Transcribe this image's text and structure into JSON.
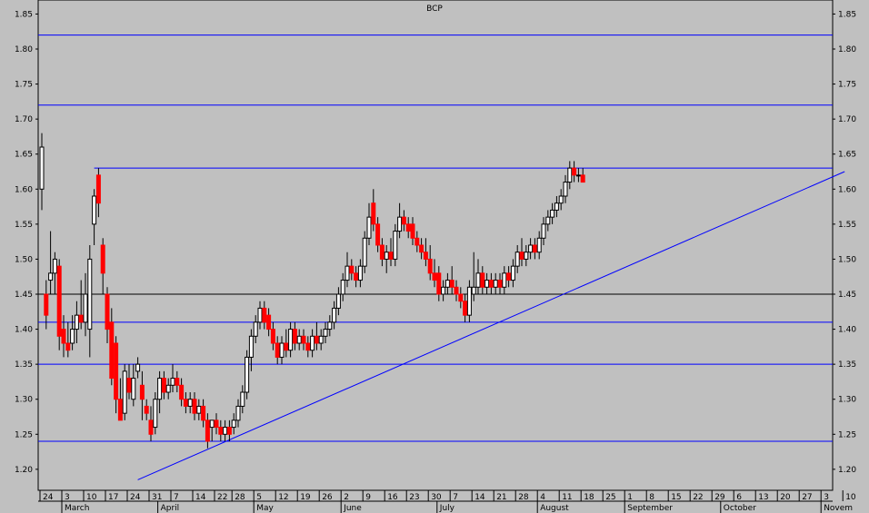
{
  "chart_data": {
    "type": "candlestick",
    "title": "BCP",
    "ylim": [
      1.17,
      1.87
    ],
    "y_ticks": [
      "1.85",
      "1.80",
      "1.75",
      "1.70",
      "1.65",
      "1.60",
      "1.55",
      "1.50",
      "1.45",
      "1.40",
      "1.35",
      "1.30",
      "1.25",
      "1.20"
    ],
    "x_range": [
      0,
      124
    ],
    "x_day_ticks": [
      {
        "label": "24",
        "x": 0
      },
      {
        "label": "3",
        "x": 5
      },
      {
        "label": "10",
        "x": 10
      },
      {
        "label": "17",
        "x": 15
      },
      {
        "label": "24",
        "x": 20
      },
      {
        "label": "31",
        "x": 25
      },
      {
        "label": "7",
        "x": 30
      },
      {
        "label": "14",
        "x": 35
      },
      {
        "label": "22",
        "x": 40
      },
      {
        "label": "28",
        "x": 44
      },
      {
        "label": "5",
        "x": 49
      },
      {
        "label": "12",
        "x": 54
      },
      {
        "label": "19",
        "x": 59
      },
      {
        "label": "26",
        "x": 64
      },
      {
        "label": "2",
        "x": 69
      },
      {
        "label": "9",
        "x": 74
      },
      {
        "label": "16",
        "x": 79
      },
      {
        "label": "23",
        "x": 84
      },
      {
        "label": "30",
        "x": 89
      },
      {
        "label": "7",
        "x": 94
      },
      {
        "label": "14",
        "x": 99
      },
      {
        "label": "21",
        "x": 104
      },
      {
        "label": "28",
        "x": 109
      },
      {
        "label": "4",
        "x": 114
      },
      {
        "label": "11",
        "x": 119
      },
      {
        "label": "18",
        "x": 124
      },
      {
        "label": "25",
        "x": 129
      },
      {
        "label": "1",
        "x": 134
      },
      {
        "label": "8",
        "x": 139
      },
      {
        "label": "15",
        "x": 144
      },
      {
        "label": "22",
        "x": 149
      },
      {
        "label": "29",
        "x": 154
      },
      {
        "label": "6",
        "x": 159
      },
      {
        "label": "13",
        "x": 164
      },
      {
        "label": "20",
        "x": 169
      },
      {
        "label": "27",
        "x": 174
      },
      {
        "label": "3",
        "x": 179
      },
      {
        "label": "10",
        "x": 184
      }
    ],
    "x_month_ticks": [
      {
        "label": "March",
        "x": 5
      },
      {
        "label": "April",
        "x": 27
      },
      {
        "label": "May",
        "x": 49
      },
      {
        "label": "June",
        "x": 69
      },
      {
        "label": "July",
        "x": 91
      },
      {
        "label": "August",
        "x": 114
      },
      {
        "label": "September",
        "x": 134
      },
      {
        "label": "October",
        "x": 156
      },
      {
        "label": "Novem",
        "x": 179
      }
    ],
    "hlines": [
      {
        "y": 1.82,
        "color": "#0000ff",
        "x_start": 0
      },
      {
        "y": 1.72,
        "color": "#0000ff",
        "x_start": 0
      },
      {
        "y": 1.63,
        "color": "#0000ff",
        "x_start": 12
      },
      {
        "y": 1.45,
        "color": "#000000",
        "x_start": 0
      },
      {
        "y": 1.41,
        "color": "#0000ff",
        "x_start": 0
      },
      {
        "y": 1.35,
        "color": "#0000ff",
        "x_start": 0
      },
      {
        "y": 1.24,
        "color": "#0000ff",
        "x_start": 0
      }
    ],
    "trendline": {
      "x1": 22,
      "y1": 1.185,
      "x2": 184,
      "y2": 1.625,
      "color": "#0000ff"
    },
    "up_color": "#ffffff",
    "down_color": "#ff0000",
    "candles": [
      {
        "x": 0,
        "o": 1.6,
        "h": 1.68,
        "l": 1.57,
        "c": 1.66
      },
      {
        "x": 1,
        "o": 1.45,
        "h": 1.47,
        "l": 1.4,
        "c": 1.42
      },
      {
        "x": 2,
        "o": 1.47,
        "h": 1.54,
        "l": 1.45,
        "c": 1.48
      },
      {
        "x": 3,
        "o": 1.48,
        "h": 1.51,
        "l": 1.45,
        "c": 1.5
      },
      {
        "x": 4,
        "o": 1.49,
        "h": 1.5,
        "l": 1.37,
        "c": 1.39
      },
      {
        "x": 5,
        "o": 1.4,
        "h": 1.42,
        "l": 1.36,
        "c": 1.38
      },
      {
        "x": 6,
        "o": 1.38,
        "h": 1.41,
        "l": 1.36,
        "c": 1.37
      },
      {
        "x": 7,
        "o": 1.38,
        "h": 1.42,
        "l": 1.37,
        "c": 1.4
      },
      {
        "x": 8,
        "o": 1.4,
        "h": 1.44,
        "l": 1.38,
        "c": 1.42
      },
      {
        "x": 9,
        "o": 1.42,
        "h": 1.47,
        "l": 1.4,
        "c": 1.41
      },
      {
        "x": 10,
        "o": 1.41,
        "h": 1.48,
        "l": 1.39,
        "c": 1.45
      },
      {
        "x": 11,
        "o": 1.4,
        "h": 1.52,
        "l": 1.36,
        "c": 1.5
      },
      {
        "x": 12,
        "o": 1.55,
        "h": 1.6,
        "l": 1.52,
        "c": 1.59
      },
      {
        "x": 13,
        "o": 1.62,
        "h": 1.63,
        "l": 1.56,
        "c": 1.58
      },
      {
        "x": 14,
        "o": 1.52,
        "h": 1.53,
        "l": 1.45,
        "c": 1.48
      },
      {
        "x": 15,
        "o": 1.45,
        "h": 1.46,
        "l": 1.38,
        "c": 1.4
      },
      {
        "x": 16,
        "o": 1.41,
        "h": 1.43,
        "l": 1.32,
        "c": 1.33
      },
      {
        "x": 17,
        "o": 1.38,
        "h": 1.39,
        "l": 1.28,
        "c": 1.3
      },
      {
        "x": 18,
        "o": 1.3,
        "h": 1.33,
        "l": 1.27,
        "c": 1.27
      },
      {
        "x": 19,
        "o": 1.28,
        "h": 1.35,
        "l": 1.27,
        "c": 1.34
      },
      {
        "x": 20,
        "o": 1.33,
        "h": 1.35,
        "l": 1.3,
        "c": 1.31
      },
      {
        "x": 21,
        "o": 1.3,
        "h": 1.35,
        "l": 1.29,
        "c": 1.33
      },
      {
        "x": 22,
        "o": 1.34,
        "h": 1.36,
        "l": 1.33,
        "c": 1.35
      },
      {
        "x": 23,
        "o": 1.32,
        "h": 1.34,
        "l": 1.27,
        "c": 1.3
      },
      {
        "x": 24,
        "o": 1.29,
        "h": 1.3,
        "l": 1.27,
        "c": 1.28
      },
      {
        "x": 25,
        "o": 1.27,
        "h": 1.29,
        "l": 1.24,
        "c": 1.25
      },
      {
        "x": 26,
        "o": 1.26,
        "h": 1.31,
        "l": 1.25,
        "c": 1.3
      },
      {
        "x": 27,
        "o": 1.3,
        "h": 1.34,
        "l": 1.28,
        "c": 1.33
      },
      {
        "x": 28,
        "o": 1.33,
        "h": 1.34,
        "l": 1.3,
        "c": 1.31
      },
      {
        "x": 29,
        "o": 1.31,
        "h": 1.33,
        "l": 1.3,
        "c": 1.32
      },
      {
        "x": 30,
        "o": 1.32,
        "h": 1.35,
        "l": 1.31,
        "c": 1.33
      },
      {
        "x": 31,
        "o": 1.33,
        "h": 1.34,
        "l": 1.31,
        "c": 1.32
      },
      {
        "x": 32,
        "o": 1.32,
        "h": 1.33,
        "l": 1.29,
        "c": 1.3
      },
      {
        "x": 33,
        "o": 1.3,
        "h": 1.31,
        "l": 1.28,
        "c": 1.29
      },
      {
        "x": 34,
        "o": 1.29,
        "h": 1.31,
        "l": 1.28,
        "c": 1.3
      },
      {
        "x": 35,
        "o": 1.3,
        "h": 1.31,
        "l": 1.27,
        "c": 1.28
      },
      {
        "x": 36,
        "o": 1.28,
        "h": 1.3,
        "l": 1.27,
        "c": 1.29
      },
      {
        "x": 37,
        "o": 1.29,
        "h": 1.3,
        "l": 1.26,
        "c": 1.27
      },
      {
        "x": 38,
        "o": 1.27,
        "h": 1.28,
        "l": 1.23,
        "c": 1.24
      },
      {
        "x": 39,
        "o": 1.26,
        "h": 1.27,
        "l": 1.24,
        "c": 1.27
      },
      {
        "x": 40,
        "o": 1.27,
        "h": 1.28,
        "l": 1.25,
        "c": 1.26
      },
      {
        "x": 41,
        "o": 1.26,
        "h": 1.27,
        "l": 1.24,
        "c": 1.25
      },
      {
        "x": 42,
        "o": 1.25,
        "h": 1.27,
        "l": 1.24,
        "c": 1.26
      },
      {
        "x": 43,
        "o": 1.26,
        "h": 1.27,
        "l": 1.24,
        "c": 1.25
      },
      {
        "x": 44,
        "o": 1.26,
        "h": 1.28,
        "l": 1.25,
        "c": 1.27
      },
      {
        "x": 45,
        "o": 1.27,
        "h": 1.3,
        "l": 1.26,
        "c": 1.29
      },
      {
        "x": 46,
        "o": 1.29,
        "h": 1.32,
        "l": 1.28,
        "c": 1.31
      },
      {
        "x": 47,
        "o": 1.31,
        "h": 1.37,
        "l": 1.3,
        "c": 1.36
      },
      {
        "x": 48,
        "o": 1.36,
        "h": 1.4,
        "l": 1.34,
        "c": 1.39
      },
      {
        "x": 49,
        "o": 1.39,
        "h": 1.42,
        "l": 1.38,
        "c": 1.41
      },
      {
        "x": 50,
        "o": 1.41,
        "h": 1.44,
        "l": 1.4,
        "c": 1.43
      },
      {
        "x": 51,
        "o": 1.43,
        "h": 1.44,
        "l": 1.4,
        "c": 1.41
      },
      {
        "x": 52,
        "o": 1.42,
        "h": 1.43,
        "l": 1.39,
        "c": 1.4
      },
      {
        "x": 53,
        "o": 1.4,
        "h": 1.41,
        "l": 1.37,
        "c": 1.38
      },
      {
        "x": 54,
        "o": 1.38,
        "h": 1.39,
        "l": 1.35,
        "c": 1.36
      },
      {
        "x": 55,
        "o": 1.36,
        "h": 1.39,
        "l": 1.35,
        "c": 1.38
      },
      {
        "x": 56,
        "o": 1.38,
        "h": 1.4,
        "l": 1.36,
        "c": 1.37
      },
      {
        "x": 57,
        "o": 1.37,
        "h": 1.41,
        "l": 1.36,
        "c": 1.4
      },
      {
        "x": 58,
        "o": 1.4,
        "h": 1.41,
        "l": 1.37,
        "c": 1.38
      },
      {
        "x": 59,
        "o": 1.38,
        "h": 1.4,
        "l": 1.37,
        "c": 1.39
      },
      {
        "x": 60,
        "o": 1.39,
        "h": 1.4,
        "l": 1.37,
        "c": 1.38
      },
      {
        "x": 61,
        "o": 1.38,
        "h": 1.39,
        "l": 1.36,
        "c": 1.37
      },
      {
        "x": 62,
        "o": 1.37,
        "h": 1.4,
        "l": 1.36,
        "c": 1.39
      },
      {
        "x": 63,
        "o": 1.39,
        "h": 1.41,
        "l": 1.37,
        "c": 1.38
      },
      {
        "x": 64,
        "o": 1.38,
        "h": 1.4,
        "l": 1.37,
        "c": 1.39
      },
      {
        "x": 65,
        "o": 1.39,
        "h": 1.41,
        "l": 1.38,
        "c": 1.4
      },
      {
        "x": 66,
        "o": 1.4,
        "h": 1.42,
        "l": 1.39,
        "c": 1.41
      },
      {
        "x": 67,
        "o": 1.41,
        "h": 1.44,
        "l": 1.4,
        "c": 1.43
      },
      {
        "x": 68,
        "o": 1.43,
        "h": 1.46,
        "l": 1.42,
        "c": 1.45
      },
      {
        "x": 69,
        "o": 1.45,
        "h": 1.48,
        "l": 1.44,
        "c": 1.47
      },
      {
        "x": 70,
        "o": 1.47,
        "h": 1.51,
        "l": 1.46,
        "c": 1.49
      },
      {
        "x": 71,
        "o": 1.49,
        "h": 1.5,
        "l": 1.47,
        "c": 1.48
      },
      {
        "x": 72,
        "o": 1.48,
        "h": 1.49,
        "l": 1.46,
        "c": 1.47
      },
      {
        "x": 73,
        "o": 1.47,
        "h": 1.5,
        "l": 1.46,
        "c": 1.49
      },
      {
        "x": 74,
        "o": 1.49,
        "h": 1.54,
        "l": 1.48,
        "c": 1.53
      },
      {
        "x": 75,
        "o": 1.53,
        "h": 1.58,
        "l": 1.52,
        "c": 1.56
      },
      {
        "x": 76,
        "o": 1.58,
        "h": 1.6,
        "l": 1.54,
        "c": 1.55
      },
      {
        "x": 77,
        "o": 1.55,
        "h": 1.56,
        "l": 1.51,
        "c": 1.52
      },
      {
        "x": 78,
        "o": 1.52,
        "h": 1.53,
        "l": 1.49,
        "c": 1.5
      },
      {
        "x": 79,
        "o": 1.5,
        "h": 1.52,
        "l": 1.48,
        "c": 1.51
      },
      {
        "x": 80,
        "o": 1.51,
        "h": 1.53,
        "l": 1.49,
        "c": 1.5
      },
      {
        "x": 81,
        "o": 1.5,
        "h": 1.55,
        "l": 1.49,
        "c": 1.54
      },
      {
        "x": 82,
        "o": 1.54,
        "h": 1.58,
        "l": 1.53,
        "c": 1.56
      },
      {
        "x": 83,
        "o": 1.56,
        "h": 1.57,
        "l": 1.54,
        "c": 1.55
      },
      {
        "x": 84,
        "o": 1.55,
        "h": 1.56,
        "l": 1.53,
        "c": 1.54
      },
      {
        "x": 85,
        "o": 1.55,
        "h": 1.56,
        "l": 1.52,
        "c": 1.53
      },
      {
        "x": 86,
        "o": 1.53,
        "h": 1.54,
        "l": 1.51,
        "c": 1.52
      },
      {
        "x": 87,
        "o": 1.52,
        "h": 1.53,
        "l": 1.5,
        "c": 1.51
      },
      {
        "x": 88,
        "o": 1.51,
        "h": 1.53,
        "l": 1.49,
        "c": 1.5
      },
      {
        "x": 89,
        "o": 1.5,
        "h": 1.52,
        "l": 1.47,
        "c": 1.48
      },
      {
        "x": 90,
        "o": 1.48,
        "h": 1.5,
        "l": 1.46,
        "c": 1.47
      },
      {
        "x": 91,
        "o": 1.48,
        "h": 1.49,
        "l": 1.44,
        "c": 1.45
      },
      {
        "x": 92,
        "o": 1.45,
        "h": 1.47,
        "l": 1.44,
        "c": 1.46
      },
      {
        "x": 93,
        "o": 1.46,
        "h": 1.48,
        "l": 1.45,
        "c": 1.47
      },
      {
        "x": 94,
        "o": 1.47,
        "h": 1.49,
        "l": 1.45,
        "c": 1.46
      },
      {
        "x": 95,
        "o": 1.46,
        "h": 1.47,
        "l": 1.44,
        "c": 1.45
      },
      {
        "x": 96,
        "o": 1.45,
        "h": 1.46,
        "l": 1.43,
        "c": 1.44
      },
      {
        "x": 97,
        "o": 1.44,
        "h": 1.45,
        "l": 1.41,
        "c": 1.42
      },
      {
        "x": 98,
        "o": 1.42,
        "h": 1.47,
        "l": 1.41,
        "c": 1.46
      },
      {
        "x": 99,
        "o": 1.45,
        "h": 1.51,
        "l": 1.44,
        "c": 1.46
      },
      {
        "x": 100,
        "o": 1.46,
        "h": 1.5,
        "l": 1.45,
        "c": 1.48
      },
      {
        "x": 101,
        "o": 1.48,
        "h": 1.49,
        "l": 1.45,
        "c": 1.46
      },
      {
        "x": 102,
        "o": 1.46,
        "h": 1.48,
        "l": 1.45,
        "c": 1.47
      },
      {
        "x": 103,
        "o": 1.47,
        "h": 1.48,
        "l": 1.45,
        "c": 1.46
      },
      {
        "x": 104,
        "o": 1.46,
        "h": 1.48,
        "l": 1.45,
        "c": 1.47
      },
      {
        "x": 105,
        "o": 1.47,
        "h": 1.48,
        "l": 1.45,
        "c": 1.46
      },
      {
        "x": 106,
        "o": 1.46,
        "h": 1.49,
        "l": 1.45,
        "c": 1.48
      },
      {
        "x": 107,
        "o": 1.48,
        "h": 1.49,
        "l": 1.46,
        "c": 1.47
      },
      {
        "x": 108,
        "o": 1.47,
        "h": 1.5,
        "l": 1.46,
        "c": 1.49
      },
      {
        "x": 109,
        "o": 1.49,
        "h": 1.52,
        "l": 1.48,
        "c": 1.51
      },
      {
        "x": 110,
        "o": 1.51,
        "h": 1.53,
        "l": 1.49,
        "c": 1.5
      },
      {
        "x": 111,
        "o": 1.5,
        "h": 1.52,
        "l": 1.49,
        "c": 1.51
      },
      {
        "x": 112,
        "o": 1.51,
        "h": 1.53,
        "l": 1.5,
        "c": 1.52
      },
      {
        "x": 113,
        "o": 1.52,
        "h": 1.53,
        "l": 1.5,
        "c": 1.51
      },
      {
        "x": 114,
        "o": 1.51,
        "h": 1.54,
        "l": 1.5,
        "c": 1.53
      },
      {
        "x": 115,
        "o": 1.53,
        "h": 1.56,
        "l": 1.52,
        "c": 1.55
      },
      {
        "x": 116,
        "o": 1.55,
        "h": 1.57,
        "l": 1.54,
        "c": 1.56
      },
      {
        "x": 117,
        "o": 1.56,
        "h": 1.58,
        "l": 1.55,
        "c": 1.57
      },
      {
        "x": 118,
        "o": 1.57,
        "h": 1.59,
        "l": 1.56,
        "c": 1.58
      },
      {
        "x": 119,
        "o": 1.58,
        "h": 1.6,
        "l": 1.57,
        "c": 1.59
      },
      {
        "x": 120,
        "o": 1.59,
        "h": 1.62,
        "l": 1.58,
        "c": 1.61
      },
      {
        "x": 121,
        "o": 1.61,
        "h": 1.64,
        "l": 1.6,
        "c": 1.63
      },
      {
        "x": 122,
        "o": 1.63,
        "h": 1.64,
        "l": 1.61,
        "c": 1.62
      },
      {
        "x": 123,
        "o": 1.62,
        "h": 1.63,
        "l": 1.61,
        "c": 1.62
      },
      {
        "x": 124,
        "o": 1.62,
        "h": 1.63,
        "l": 1.61,
        "c": 1.61
      }
    ]
  }
}
